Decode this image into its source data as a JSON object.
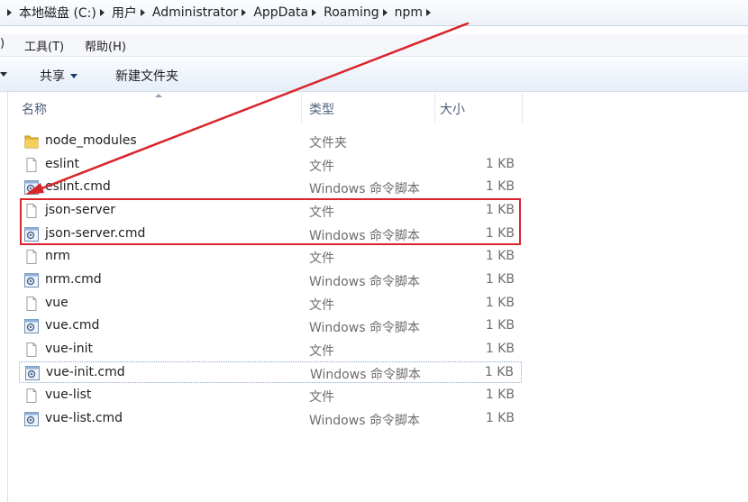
{
  "address": {
    "crumbs": [
      "本地磁盘 (C:)",
      "用户",
      "Administrator",
      "AppData",
      "Roaming",
      "npm"
    ]
  },
  "menu": {
    "items": [
      "工具(T)",
      "帮助(H)"
    ],
    "cut_left": ")"
  },
  "toolbar": {
    "share_label": "共享",
    "new_folder_label": "新建文件夹"
  },
  "columns": {
    "name": "名称",
    "type": "类型",
    "size": "大小"
  },
  "files": [
    {
      "name": "node_modules",
      "type": "文件夹",
      "size": "",
      "icon": "folder-icon"
    },
    {
      "name": "eslint",
      "type": "文件",
      "size": "1 KB",
      "icon": "file-icon"
    },
    {
      "name": "eslint.cmd",
      "type": "Windows 命令脚本",
      "size": "1 KB",
      "icon": "cmd-script-icon"
    },
    {
      "name": "json-server",
      "type": "文件",
      "size": "1 KB",
      "icon": "file-icon"
    },
    {
      "name": "json-server.cmd",
      "type": "Windows 命令脚本",
      "size": "1 KB",
      "icon": "cmd-script-icon"
    },
    {
      "name": "nrm",
      "type": "文件",
      "size": "1 KB",
      "icon": "file-icon"
    },
    {
      "name": "nrm.cmd",
      "type": "Windows 命令脚本",
      "size": "1 KB",
      "icon": "cmd-script-icon"
    },
    {
      "name": "vue",
      "type": "文件",
      "size": "1 KB",
      "icon": "file-icon"
    },
    {
      "name": "vue.cmd",
      "type": "Windows 命令脚本",
      "size": "1 KB",
      "icon": "cmd-script-icon"
    },
    {
      "name": "vue-init",
      "type": "文件",
      "size": "1 KB",
      "icon": "file-icon"
    },
    {
      "name": "vue-init.cmd",
      "type": "Windows 命令脚本",
      "size": "1 KB",
      "icon": "cmd-script-icon"
    },
    {
      "name": "vue-list",
      "type": "文件",
      "size": "1 KB",
      "icon": "file-icon"
    },
    {
      "name": "vue-list.cmd",
      "type": "Windows 命令脚本",
      "size": "1 KB",
      "icon": "cmd-script-icon"
    }
  ],
  "annotation": {
    "color": "#d9242b",
    "highlighted_items": [
      "json-server",
      "json-server.cmd"
    ]
  }
}
